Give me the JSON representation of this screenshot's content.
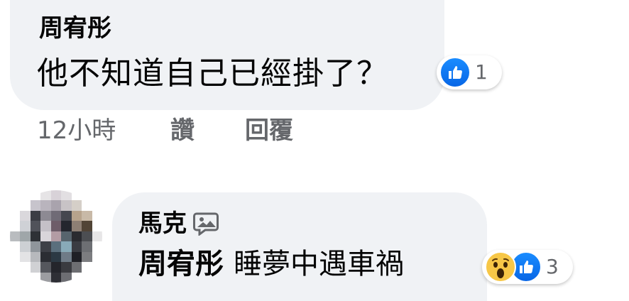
{
  "comments": [
    {
      "author": "周宥彤",
      "text": "他不知道自己已經掛了？",
      "reactions": {
        "icons": [
          "like-icon"
        ],
        "count": "1"
      },
      "actions": {
        "time": "12小時",
        "like": "讚",
        "reply": "回覆"
      }
    },
    {
      "author": "馬克",
      "badge_icon": "speech-bubble-image-icon",
      "tagged_user": "周宥彤",
      "text": "睡夢中遇車禍",
      "reactions": {
        "icons": [
          "wow-icon",
          "like-icon"
        ],
        "count": "3"
      }
    }
  ],
  "colors": {
    "bubble_bg": "#f0f2f5",
    "meta_text": "#65676b",
    "like_blue": "#0766e6",
    "wow_yellow": "#f7c747"
  }
}
